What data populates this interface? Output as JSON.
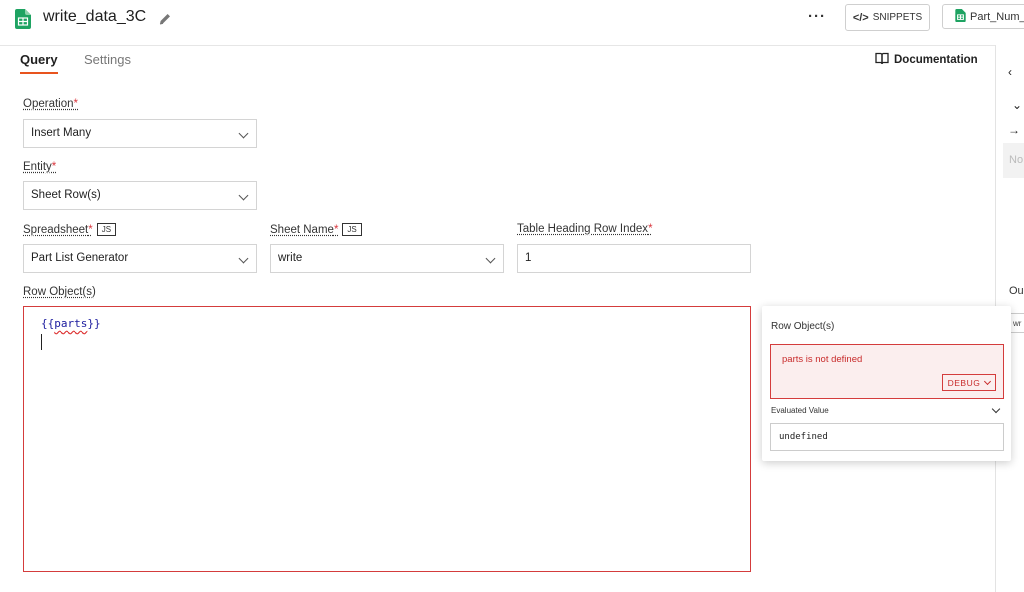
{
  "header": {
    "title": "write_data_3C",
    "more_label": "···",
    "snippets_label": "SNIPPETS",
    "snippets_icon_label": "</>",
    "partnum_label": "Part_Num_"
  },
  "tabs": [
    {
      "label": "Query",
      "active": true
    },
    {
      "label": "Settings",
      "active": false
    }
  ],
  "documentation_label": "Documentation",
  "form": {
    "operation": {
      "label": "Operation",
      "required": "*",
      "value": "Insert Many"
    },
    "entity": {
      "label": "Entity",
      "required": "*",
      "value": "Sheet Row(s)"
    },
    "spreadsheet": {
      "label": "Spreadsheet",
      "required": "*",
      "badge": "JS",
      "value": "Part List Generator"
    },
    "sheet_name": {
      "label": "Sheet Name",
      "required": "*",
      "badge": "JS",
      "value": "write"
    },
    "table_heading": {
      "label": "Table Heading Row Index",
      "required": "*",
      "value": "1"
    },
    "row_objects": {
      "label": "Row Object(s)",
      "code_open": "{{",
      "code_var": "parts",
      "code_close": "}}"
    }
  },
  "popover": {
    "title": "Row Object(s)",
    "error": "parts is not defined",
    "debug_label": "DEBUG",
    "evaluated_label": "Evaluated Value",
    "evaluated_value": "undefined"
  },
  "side_panel": {
    "grey_text": "No",
    "out_text": "Ou",
    "box_text": "wr"
  },
  "colors": {
    "accent": "#e8541e",
    "error": "#d43c3c",
    "sheets_green": "#1ea362"
  }
}
